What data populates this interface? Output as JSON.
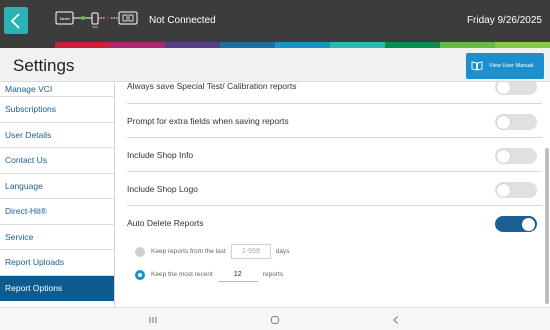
{
  "header": {
    "back_icon": "chevron-left-icon",
    "connection_status": "Not Connected",
    "date": "Friday 9/26/2025",
    "tablet_label": "Tablet",
    "colors": {
      "topbar": "#3c3c3c",
      "accent": "#2bb3b3"
    }
  },
  "stripe_colors": [
    "#3c3c3c",
    "#cd1f3a",
    "#a72a6e",
    "#573d8c",
    "#1c6ea8",
    "#1e92c8",
    "#30b7b1",
    "#0b8d4f",
    "#5fbf3c",
    "#83c84a"
  ],
  "page": {
    "title": "Settings",
    "manual_button": "View User Manual"
  },
  "sidebar": {
    "items": [
      {
        "label": "Manage VCI",
        "active": false
      },
      {
        "label": "Subscriptions",
        "active": false
      },
      {
        "label": "User Details",
        "active": false
      },
      {
        "label": "Contact Us",
        "active": false
      },
      {
        "label": "Language",
        "active": false
      },
      {
        "label": "Direct-Hit®",
        "active": false
      },
      {
        "label": "Service",
        "active": false
      },
      {
        "label": "Report Uploads",
        "active": false
      },
      {
        "label": "Report Options",
        "active": true
      }
    ]
  },
  "settings": {
    "rows": [
      {
        "label": "Always save Special Test/ Calibration reports",
        "on": false
      },
      {
        "label": "Prompt for extra fields when saving reports",
        "on": false
      },
      {
        "label": "Include Shop Info",
        "on": false
      },
      {
        "label": "Include Shop Logo",
        "on": false
      },
      {
        "label": "Auto Delete Reports",
        "on": true
      }
    ],
    "keep_days": {
      "prefix": "Keep reports from the last",
      "placeholder": "1-999",
      "suffix": "days",
      "selected": false
    },
    "keep_count": {
      "prefix": "Keep the most recent",
      "value": "12",
      "suffix": "reports",
      "selected": true
    }
  },
  "toggle_colors": {
    "on": "#1b5f95",
    "off": "#e0e0e0"
  }
}
